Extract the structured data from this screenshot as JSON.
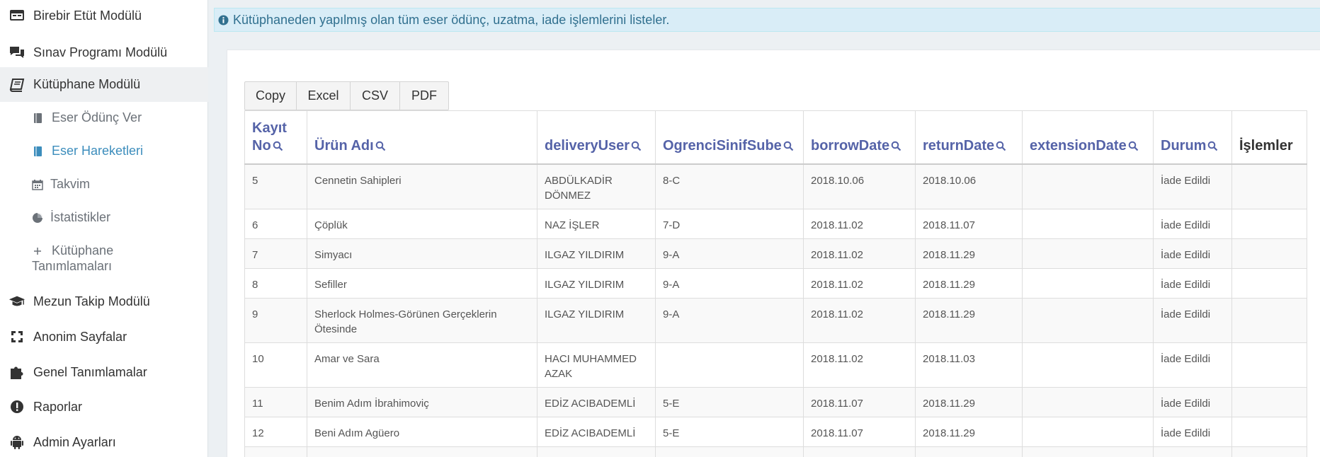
{
  "sidebar": {
    "items": [
      {
        "label": "Birebir Etüt Modülü",
        "icon": "monitor-icon"
      },
      {
        "label": "Sınav Programı Modülü",
        "icon": "comments-icon"
      },
      {
        "label": "Kütüphane Modülü",
        "icon": "book-icon"
      },
      {
        "label": "Mezun Takip Modülü",
        "icon": "graduation-cap-icon"
      },
      {
        "label": "Anonim Sayfalar",
        "icon": "expand-icon"
      },
      {
        "label": "Genel Tanımlamalar",
        "icon": "puzzle-icon"
      },
      {
        "label": "Raporlar",
        "icon": "exclamation-circle-icon"
      },
      {
        "label": "Admin Ayarları",
        "icon": "android-icon"
      }
    ],
    "subitems": [
      {
        "label": "Eser Ödünç Ver",
        "icon": "bookmark-icon"
      },
      {
        "label": "Eser Hareketleri",
        "icon": "bookmark-icon"
      },
      {
        "label": "Takvim",
        "icon": "calendar-icon"
      },
      {
        "label": "İstatistikler",
        "icon": "pie-chart-icon"
      },
      {
        "label_line1": "Kütüphane",
        "label_line2": "Tanımlamaları",
        "icon": "plus-icon"
      }
    ]
  },
  "info": {
    "text": "Kütüphaneden yapılmış olan tüm eser ödünç, uzatma, iade işlemlerini listeler."
  },
  "export_buttons": [
    "Copy",
    "Excel",
    "CSV",
    "PDF"
  ],
  "table": {
    "headers": {
      "kayit_no_line1": "Kayıt",
      "kayit_no_line2": "No",
      "urun_adi": "Ürün Adı",
      "delivery_user": "deliveryUser",
      "ogrenci_sinif_sube": "OgrenciSinifSube",
      "borrow_date": "borrowDate",
      "return_date": "returnDate",
      "extension_date": "extensionDate",
      "durum": "Durum",
      "islemler": "İşlemler"
    },
    "rows": [
      {
        "no": "5",
        "name1": "Cennetin Sahipleri",
        "name2": "",
        "user1": "ABDÜLKADİR",
        "user2": "DÖNMEZ",
        "sube": "8-C",
        "borrow": "2018.10.06",
        "ret": "2018.10.06",
        "ext": "",
        "durum": "İade Edildi"
      },
      {
        "no": "6",
        "name1": "Çöplük",
        "name2": "",
        "user1": "NAZ İŞLER",
        "user2": "",
        "sube": "7-D",
        "borrow": "2018.11.02",
        "ret": "2018.11.07",
        "ext": "",
        "durum": "İade Edildi"
      },
      {
        "no": "7",
        "name1": "Simyacı",
        "name2": "",
        "user1": "ILGAZ YILDIRIM",
        "user2": "",
        "sube": "9-A",
        "borrow": "2018.11.02",
        "ret": "2018.11.29",
        "ext": "",
        "durum": "İade Edildi"
      },
      {
        "no": "8",
        "name1": "Sefiller",
        "name2": "",
        "user1": "ILGAZ YILDIRIM",
        "user2": "",
        "sube": "9-A",
        "borrow": "2018.11.02",
        "ret": "2018.11.29",
        "ext": "",
        "durum": "İade Edildi"
      },
      {
        "no": "9",
        "name1": "Sherlock Holmes-Görünen Gerçeklerin",
        "name2": "Ötesinde",
        "user1": "ILGAZ YILDIRIM",
        "user2": "",
        "sube": "9-A",
        "borrow": "2018.11.02",
        "ret": "2018.11.29",
        "ext": "",
        "durum": "İade Edildi"
      },
      {
        "no": "10",
        "name1": "Amar ve Sara",
        "name2": "",
        "user1": "HACI MUHAMMED",
        "user2": "AZAK",
        "sube": "",
        "borrow": "2018.11.02",
        "ret": "2018.11.03",
        "ext": "",
        "durum": "İade Edildi"
      },
      {
        "no": "11",
        "name1": "Benim Adım İbrahimoviç",
        "name2": "",
        "user1": "EDİZ ACIBADEMLİ",
        "user2": "",
        "sube": "5-E",
        "borrow": "2018.11.07",
        "ret": "2018.11.29",
        "ext": "",
        "durum": "İade Edildi"
      },
      {
        "no": "12",
        "name1": "Beni Adım Agüero",
        "name2": "",
        "user1": "EDİZ ACIBADEMLİ",
        "user2": "",
        "sube": "5-E",
        "borrow": "2018.11.07",
        "ret": "2018.11.29",
        "ext": "",
        "durum": "İade Edildi"
      }
    ]
  },
  "colors": {
    "accent": "#3c8dbc",
    "header_text": "#5563a8",
    "info_bg": "#d9edf7",
    "info_text": "#31708f"
  }
}
